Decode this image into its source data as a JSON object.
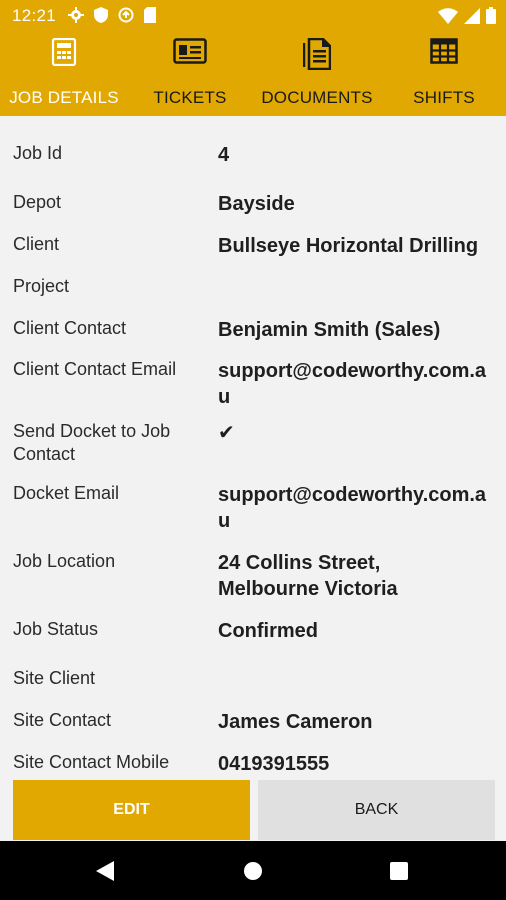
{
  "status_bar": {
    "time": "12:21"
  },
  "tabs": [
    {
      "label": "JOB DETAILS",
      "icon": "calculator-icon",
      "active": true
    },
    {
      "label": "TICKETS",
      "icon": "id-card-icon",
      "active": false
    },
    {
      "label": "DOCUMENTS",
      "icon": "documents-icon",
      "active": false
    },
    {
      "label": "SHIFTS",
      "icon": "grid-table-icon",
      "active": false
    }
  ],
  "details": [
    {
      "label": "Job Id",
      "value": "4"
    },
    {
      "label": "Depot",
      "value": "Bayside"
    },
    {
      "label": "Client",
      "value": "Bullseye Horizontal Drilling"
    },
    {
      "label": "Project",
      "value": ""
    },
    {
      "label": "Client Contact",
      "value": "Benjamin Smith (Sales)"
    },
    {
      "label": "Client Contact Email",
      "value": "support@codeworthy.com.au"
    },
    {
      "label": "Send Docket to Job Contact",
      "value": "✔"
    },
    {
      "label": "Docket Email",
      "value": "support@codeworthy.com.au"
    },
    {
      "label": "Job Location",
      "value": "24 Collins Street, Melbourne Victoria"
    },
    {
      "label": "Job Status",
      "value": "Confirmed"
    },
    {
      "label": "Site Client",
      "value": ""
    },
    {
      "label": "Site Contact",
      "value": "James Cameron"
    },
    {
      "label": "Site Contact Mobile",
      "value": "0419391555"
    }
  ],
  "buttons": {
    "edit": "EDIT",
    "back": "BACK"
  },
  "colors": {
    "accent": "#e0a800",
    "background": "#f2f2f2",
    "back_button": "#e0e0e0"
  }
}
